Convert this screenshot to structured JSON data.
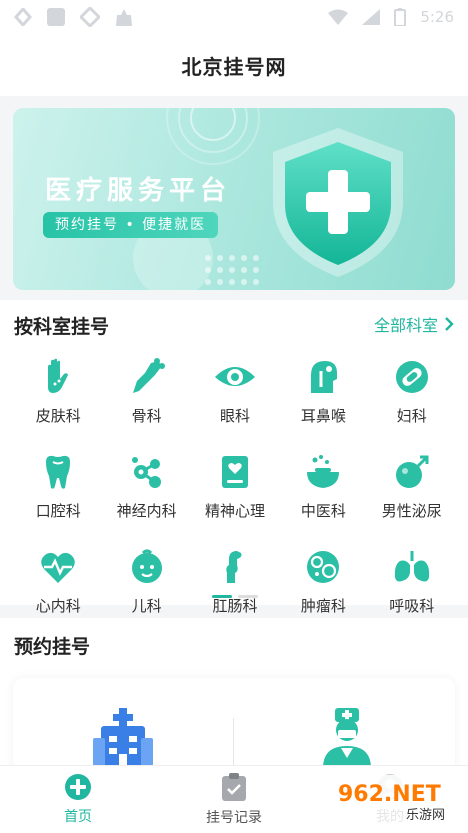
{
  "status_bar": {
    "time": "5:26"
  },
  "header": {
    "title": "北京挂号网"
  },
  "banner": {
    "title": "医疗服务平台",
    "subtitle": "预约挂号 • 便捷就医"
  },
  "departments_section": {
    "title": "按科室挂号",
    "all_link": "全部科室",
    "items": [
      {
        "label": "皮肤科",
        "icon": "hand-icon"
      },
      {
        "label": "骨科",
        "icon": "bone-icon"
      },
      {
        "label": "眼科",
        "icon": "eye-icon"
      },
      {
        "label": "耳鼻喉",
        "icon": "ear-nose-throat-icon"
      },
      {
        "label": "妇科",
        "icon": "bandage-icon"
      },
      {
        "label": "口腔科",
        "icon": "tooth-icon"
      },
      {
        "label": "神经内科",
        "icon": "neuron-icon"
      },
      {
        "label": "精神心理",
        "icon": "heart-board-icon"
      },
      {
        "label": "中医科",
        "icon": "mortar-icon"
      },
      {
        "label": "男性泌尿",
        "icon": "male-symbol-icon"
      },
      {
        "label": "心内科",
        "icon": "heartbeat-icon"
      },
      {
        "label": "儿科",
        "icon": "baby-icon"
      },
      {
        "label": "肛肠科",
        "icon": "intestine-icon"
      },
      {
        "label": "肿瘤科",
        "icon": "cells-icon"
      },
      {
        "label": "呼吸科",
        "icon": "lungs-icon"
      }
    ]
  },
  "registration_section": {
    "title": "预约挂号"
  },
  "tab_bar": {
    "items": [
      {
        "label": "首页",
        "icon": "plus-circle-icon",
        "active": true
      },
      {
        "label": "挂号记录",
        "icon": "clipboard-icon",
        "active": false
      },
      {
        "label": "我的",
        "icon": "user-icon",
        "active": false
      }
    ]
  },
  "watermark": {
    "text": "962.NET",
    "subtext": "乐游网"
  },
  "colors": {
    "accent": "#21b6a0",
    "accent_light": "#4fd6bd"
  }
}
